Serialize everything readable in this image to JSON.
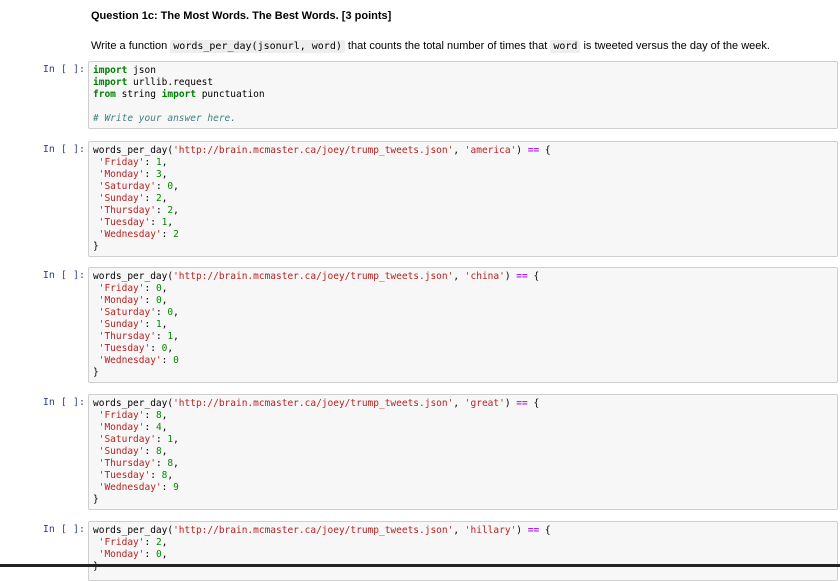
{
  "markdown": {
    "title": "Question 1c: The Most Words. The Best Words. [3 points]",
    "text_before": "Write a function ",
    "code_fn": "words_per_day(jsonurl, word)",
    "text_middle": " that counts the total number of times that ",
    "code_word": "word",
    "text_after": " is tweeted versus the day of the week."
  },
  "prompt_label": "In [ ]:",
  "cell1": {
    "imports": [
      "import json",
      "import urllib.request",
      "from string import punctuation"
    ],
    "comment": "# Write your answer here."
  },
  "url": "'http://brain.mcmaster.ca/joey/trump_tweets.json'",
  "tests": [
    {
      "word": "'america'",
      "rows": [
        {
          "day": "'Friday'",
          "value": "1"
        },
        {
          "day": "'Monday'",
          "value": "3"
        },
        {
          "day": "'Saturday'",
          "value": "0"
        },
        {
          "day": "'Sunday'",
          "value": "2"
        },
        {
          "day": "'Thursday'",
          "value": "2"
        },
        {
          "day": "'Tuesday'",
          "value": "1"
        },
        {
          "day": "'Wednesday'",
          "value": "2"
        }
      ]
    },
    {
      "word": "'china'",
      "rows": [
        {
          "day": "'Friday'",
          "value": "0"
        },
        {
          "day": "'Monday'",
          "value": "0"
        },
        {
          "day": "'Saturday'",
          "value": "0"
        },
        {
          "day": "'Sunday'",
          "value": "1"
        },
        {
          "day": "'Thursday'",
          "value": "1"
        },
        {
          "day": "'Tuesday'",
          "value": "0"
        },
        {
          "day": "'Wednesday'",
          "value": "0"
        }
      ]
    },
    {
      "word": "'great'",
      "rows": [
        {
          "day": "'Friday'",
          "value": "8"
        },
        {
          "day": "'Monday'",
          "value": "4"
        },
        {
          "day": "'Saturday'",
          "value": "1"
        },
        {
          "day": "'Sunday'",
          "value": "8"
        },
        {
          "day": "'Thursday'",
          "value": "8"
        },
        {
          "day": "'Tuesday'",
          "value": "8"
        },
        {
          "day": "'Wednesday'",
          "value": "9"
        }
      ]
    },
    {
      "word": "'hillary'",
      "rows": [
        {
          "day": "'Friday'",
          "value": "2"
        },
        {
          "day": "'Monday'",
          "value": "0"
        }
      ]
    }
  ]
}
